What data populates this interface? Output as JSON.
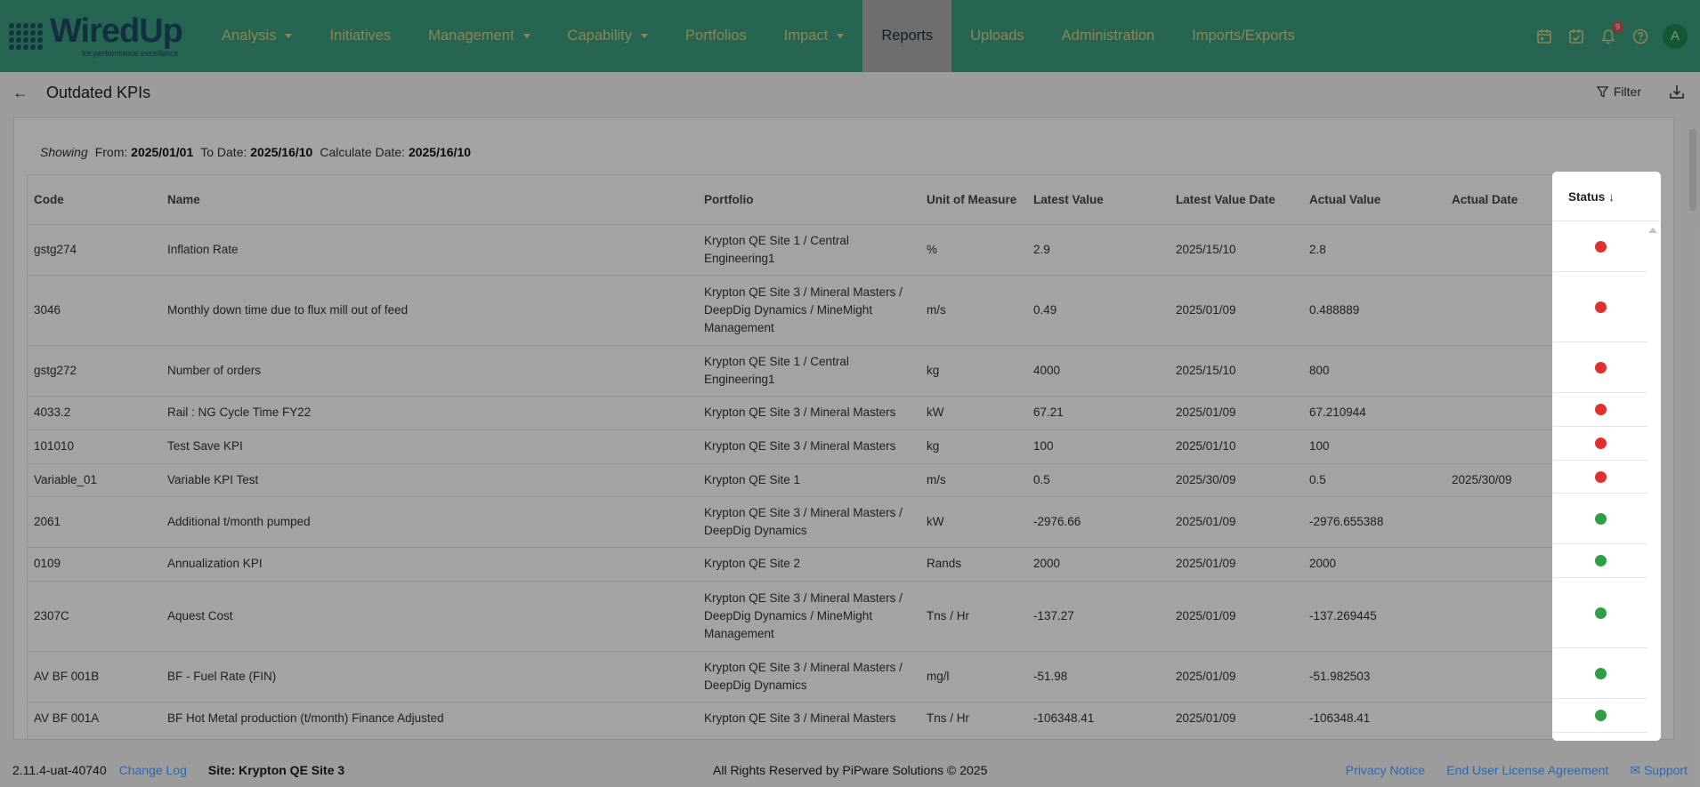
{
  "brand": {
    "name": "WiredUp",
    "tagline": "for performance excellence"
  },
  "nav": [
    {
      "label": "Analysis",
      "dropdown": true
    },
    {
      "label": "Initiatives",
      "dropdown": false
    },
    {
      "label": "Management",
      "dropdown": true
    },
    {
      "label": "Capability",
      "dropdown": true
    },
    {
      "label": "Portfolios",
      "dropdown": false
    },
    {
      "label": "Impact",
      "dropdown": true
    },
    {
      "label": "Reports",
      "dropdown": false,
      "active": true
    },
    {
      "label": "Uploads",
      "dropdown": false
    },
    {
      "label": "Administration",
      "dropdown": false
    },
    {
      "label": "Imports/Exports",
      "dropdown": false
    }
  ],
  "top_icons": {
    "notification_count": "9",
    "avatar_initial": "A"
  },
  "page": {
    "title": "Outdated KPIs",
    "filter_label": "Filter"
  },
  "showing": {
    "label": "Showing",
    "from_label": "From:",
    "from": "2025/01/01",
    "to_label": "To Date:",
    "to": "2025/16/10",
    "calc_label": "Calculate Date:",
    "calc": "2025/16/10"
  },
  "table": {
    "columns": [
      "Code",
      "Name",
      "Portfolio",
      "Unit of Measure",
      "Latest Value",
      "Latest Value Date",
      "Actual Value",
      "Actual Date",
      "Status"
    ],
    "rows": [
      {
        "code": "gstg274",
        "name": "Inflation Rate",
        "portfolio": "Krypton QE Site 1 / Central Engineering1",
        "unit": "%",
        "latest": "2.9",
        "latest_date": "2025/15/10",
        "actual": "2.8",
        "actual_date": "",
        "status": "red"
      },
      {
        "code": "3046",
        "name": "Monthly down time due to flux mill out of feed",
        "portfolio": "Krypton QE Site 3 / Mineral Masters / DeepDig Dynamics / MineMight Management",
        "unit": "m/s",
        "latest": "0.49",
        "latest_date": "2025/01/09",
        "actual": "0.488889",
        "actual_date": "",
        "status": "red"
      },
      {
        "code": "gstg272",
        "name": "Number of orders",
        "portfolio": "Krypton QE Site 1 / Central Engineering1",
        "unit": "kg",
        "latest": "4000",
        "latest_date": "2025/15/10",
        "actual": "800",
        "actual_date": "",
        "status": "red"
      },
      {
        "code": "4033.2",
        "name": "Rail : NG Cycle Time FY22",
        "portfolio": "Krypton QE Site 3 / Mineral Masters",
        "unit": "kW",
        "latest": "67.21",
        "latest_date": "2025/01/09",
        "actual": "67.210944",
        "actual_date": "",
        "status": "red"
      },
      {
        "code": "101010",
        "name": "Test Save KPI",
        "portfolio": "Krypton QE Site 3 / Mineral Masters",
        "unit": "kg",
        "latest": "100",
        "latest_date": "2025/01/10",
        "actual": "100",
        "actual_date": "",
        "status": "red"
      },
      {
        "code": "Variable_01",
        "name": "Variable KPI Test",
        "portfolio": "Krypton QE Site 1",
        "unit": "m/s",
        "latest": "0.5",
        "latest_date": "2025/30/09",
        "actual": "0.5",
        "actual_date": "2025/30/09",
        "status": "red"
      },
      {
        "code": "2061",
        "name": "Additional t/month pumped",
        "portfolio": "Krypton QE Site 3 / Mineral Masters / DeepDig Dynamics",
        "unit": "kW",
        "latest": "-2976.66",
        "latest_date": "2025/01/09",
        "actual": "-2976.655388",
        "actual_date": "",
        "status": "green"
      },
      {
        "code": "0109",
        "name": "Annualization KPI",
        "portfolio": "Krypton QE Site 2",
        "unit": "Rands",
        "latest": "2000",
        "latest_date": "2025/01/09",
        "actual": "2000",
        "actual_date": "",
        "status": "green"
      },
      {
        "code": "2307C",
        "name": "Aquest Cost",
        "portfolio": "Krypton QE Site 3 / Mineral Masters / DeepDig Dynamics / MineMight Management",
        "unit": "Tns / Hr",
        "latest": "-137.27",
        "latest_date": "2025/01/09",
        "actual": "-137.269445",
        "actual_date": "",
        "status": "green"
      },
      {
        "code": "AV BF 001B",
        "name": "BF - Fuel Rate (FIN)",
        "portfolio": "Krypton QE Site 3 / Mineral Masters / DeepDig Dynamics",
        "unit": "mg/l",
        "latest": "-51.98",
        "latest_date": "2025/01/09",
        "actual": "-51.982503",
        "actual_date": "",
        "status": "green"
      },
      {
        "code": "AV BF 001A",
        "name": "BF Hot Metal production (t/month) Finance Adjusted",
        "portfolio": "Krypton QE Site 3 / Mineral Masters",
        "unit": "Tns / Hr",
        "latest": "-106348.41",
        "latest_date": "2025/01/09",
        "actual": "-106348.41",
        "actual_date": "",
        "status": "green"
      }
    ]
  },
  "footer": {
    "version": "2.11.4-uat-40740",
    "changelog": "Change Log",
    "site": "Site: Krypton QE Site 3",
    "copyright": "All Rights Reserved by PiPware Solutions © 2025",
    "privacy": "Privacy Notice",
    "eula": "End User License Agreement",
    "support": "Support"
  },
  "colors": {
    "nav_bg": "#3a9e80",
    "nav_text": "#d9d08a",
    "status_red": "#e03131",
    "status_green": "#2f9e44",
    "link": "#2b67b0"
  }
}
